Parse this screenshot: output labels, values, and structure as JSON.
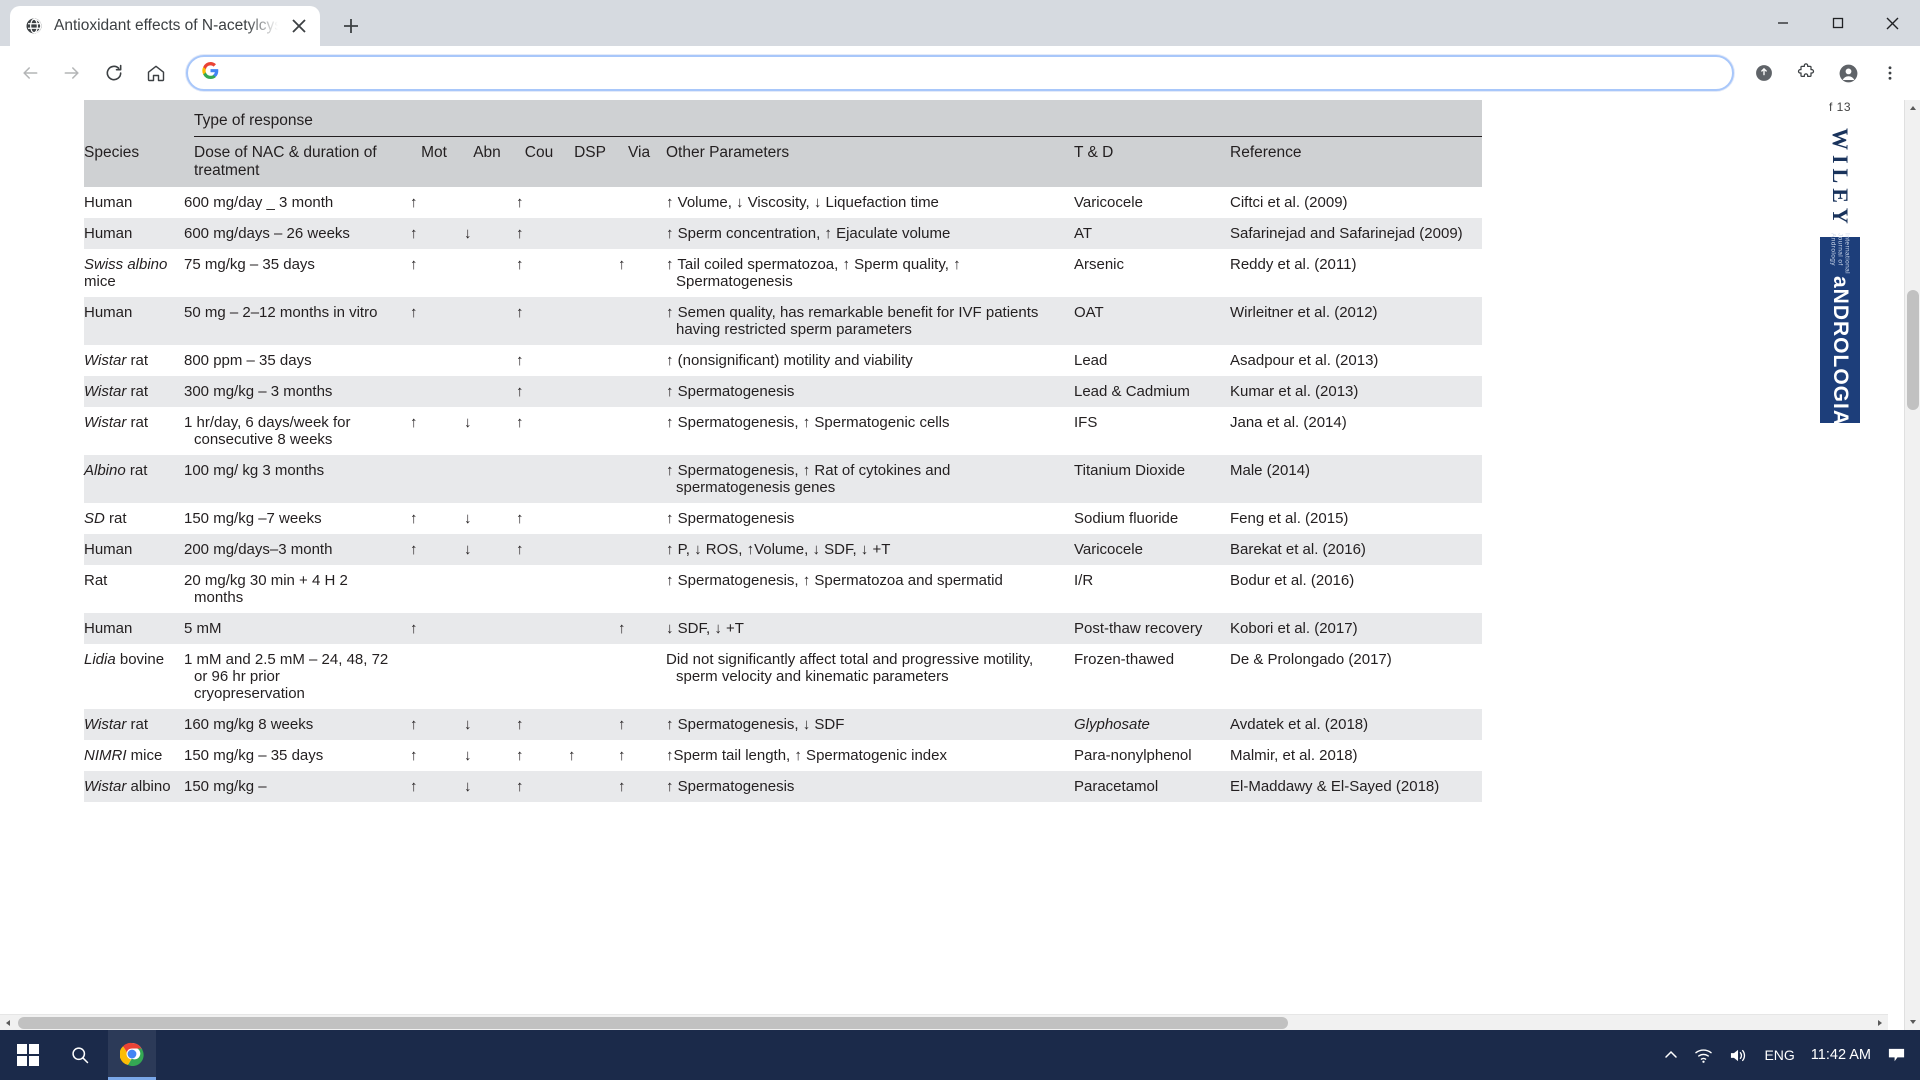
{
  "browser": {
    "tab": {
      "title": "Antioxidant effects of N-acetylcys",
      "favicon": "globe-icon",
      "close": "close-icon"
    },
    "new_tab_label": "+",
    "window_controls": {
      "minimize": "minimize-icon",
      "maximize": "maximize-icon",
      "close": "close-icon"
    },
    "toolbar": {
      "back": "back-arrow-icon",
      "forward": "forward-arrow-icon",
      "reload": "reload-icon",
      "home": "home-icon",
      "omnibox_value": "",
      "omnibox_placeholder": "",
      "search_icon": "google-g-icon",
      "share": "share-icon",
      "extensions": "puzzle-piece-icon",
      "profile": "profile-avatar-icon",
      "menu": "three-dot-menu-icon"
    }
  },
  "rail": {
    "page_label": "f 13",
    "publisher": "WILEY",
    "journal_sub": "International Journal of Andrology",
    "journal": "aNDROLOGIA"
  },
  "table": {
    "group_header": "Type of response",
    "columns": [
      "Species",
      "Dose of NAC & duration of treatment",
      "Mot",
      "Abn",
      "Cou",
      "DSP",
      "Via",
      "Other Parameters",
      "T & D",
      "Reference"
    ],
    "rows": [
      {
        "species": "Human",
        "species_italic": "",
        "dose": "600 mg/day _ 3 month",
        "mot": "↑",
        "abn": "",
        "cou": "↑",
        "dsp": "",
        "via": "",
        "other": "↑ Volume, ↓ Viscosity, ↓ Liquefaction time",
        "td": "Varicocele",
        "td_italic": false,
        "ref": "Ciftci et al. (2009)"
      },
      {
        "species": "Human",
        "species_italic": "",
        "dose": "600 mg/days – 26 weeks",
        "mot": "↑",
        "abn": "↓",
        "cou": "↑",
        "dsp": "",
        "via": "",
        "other": "↑ Sperm concentration, ↑ Ejaculate volume",
        "td": "AT",
        "td_italic": false,
        "ref": "Safarinejad and Safarinejad (2009)"
      },
      {
        "species": "mice",
        "species_italic": "Swiss albino",
        "dose": "75 mg/kg – 35 days",
        "mot": "↑",
        "abn": "",
        "cou": "↑",
        "dsp": "",
        "via": "↑",
        "other": "↑ Tail coiled spermatozoa, ↑ Sperm quality, ↑ Spermatogenesis",
        "td": "Arsenic",
        "td_italic": false,
        "ref": "Reddy et al. (2011)"
      },
      {
        "species": "Human",
        "species_italic": "",
        "dose": "50 mg – 2–12 months in vitro",
        "mot": "↑",
        "abn": "",
        "cou": "↑",
        "dsp": "",
        "via": "",
        "other": "↑ Semen quality, has remarkable benefit for IVF patients having restricted sperm parameters",
        "td": "OAT",
        "td_italic": false,
        "ref": "Wirleitner et al. (2012)"
      },
      {
        "species": "rat",
        "species_italic": "Wistar",
        "dose": "800 ppm – 35 days",
        "mot": "",
        "abn": "",
        "cou": "↑",
        "dsp": "",
        "via": "",
        "other": "↑ (nonsignificant) motility and viability",
        "td": "Lead",
        "td_italic": false,
        "ref": "Asadpour et al. (2013)"
      },
      {
        "species": "rat",
        "species_italic": "Wistar",
        "dose": "300 mg/kg – 3 months",
        "mot": "",
        "abn": "",
        "cou": "↑",
        "dsp": "",
        "via": "",
        "other": "↑ Spermatogenesis",
        "td": "Lead & Cadmium",
        "td_italic": false,
        "ref": "Kumar et al. (2013)"
      },
      {
        "species": "rat",
        "species_italic": "Wistar",
        "dose": "1 hr/day, 6 days/week for consecutive 8 weeks",
        "mot": "↑",
        "abn": "↓",
        "cou": "↑",
        "dsp": "",
        "via": "",
        "other": "↑ Spermatogenesis, ↑ Spermatogenic cells",
        "td": "IFS",
        "td_italic": false,
        "ref": "Jana et al. (2014)"
      },
      {
        "species": "rat",
        "species_italic": "Albino",
        "dose": "100 mg/ kg 3 months",
        "mot": "",
        "abn": "",
        "cou": "",
        "dsp": "",
        "via": "",
        "other": "↑ Spermatogenesis, ↑ Rat of cytokines and spermatogenesis genes",
        "td": "Titanium Dioxide",
        "td_italic": false,
        "ref": "Male (2014)"
      },
      {
        "species": "rat",
        "species_italic": "SD",
        "dose": "150 mg/kg –7 weeks",
        "mot": "↑",
        "abn": "↓",
        "cou": "↑",
        "dsp": "",
        "via": "",
        "other": "↑ Spermatogenesis",
        "td": "Sodium fluoride",
        "td_italic": false,
        "ref": "Feng et al. (2015)"
      },
      {
        "species": "Human",
        "species_italic": "",
        "dose": "200 mg/days–3 month",
        "mot": "↑",
        "abn": "↓",
        "cou": "↑",
        "dsp": "",
        "via": "",
        "other": "↑ P, ↓ ROS, ↑Volume, ↓ SDF, ↓ +T",
        "td": "Varicocele",
        "td_italic": false,
        "ref": "Barekat et al. (2016)"
      },
      {
        "species": "Rat",
        "species_italic": "",
        "dose": "20 mg/kg 30 min + 4 H 2 months",
        "mot": "",
        "abn": "",
        "cou": "",
        "dsp": "",
        "via": "",
        "other": "↑ Spermatogenesis, ↑ Spermatozoa and spermatid",
        "td": "I/R",
        "td_italic": false,
        "ref": "Bodur et al. (2016)"
      },
      {
        "species": "Human",
        "species_italic": "",
        "dose": "5 mM",
        "mot": "↑",
        "abn": "",
        "cou": "",
        "dsp": "",
        "via": "↑",
        "other": "↓ SDF, ↓ +T",
        "td": "Post-thaw recovery",
        "td_italic": false,
        "ref": "Kobori et al. (2017)"
      },
      {
        "species": "bovine",
        "species_italic": "Lidia",
        "dose": "1 mM and 2.5 mM – 24, 48, 72 or 96 hr prior cryopreservation",
        "mot": "",
        "abn": "",
        "cou": "",
        "dsp": "",
        "via": "",
        "other": "Did not significantly affect total and progressive motility, sperm velocity and kinematic parameters",
        "td": "Frozen-thawed",
        "td_italic": false,
        "ref": "De & Prolongado (2017)"
      },
      {
        "species": "rat",
        "species_italic": "Wistar",
        "dose": "160 mg/kg 8 weeks",
        "mot": "↑",
        "abn": "↓",
        "cou": "↑",
        "dsp": "",
        "via": "↑",
        "other": "↑ Spermatogenesis, ↓ SDF",
        "td": "Glyphosate",
        "td_italic": true,
        "ref": "Avdatek et al. (2018)"
      },
      {
        "species": "mice",
        "species_italic": "NIMRI",
        "dose": "150 mg/kg – 35 days",
        "mot": "↑",
        "abn": "↓",
        "cou": "↑",
        "dsp": "↑",
        "via": "↑",
        "other": "↑Sperm tail length, ↑ Spermatogenic index",
        "td": "Para-nonylphenol",
        "td_italic": false,
        "ref": "Malmir, et al. 2018)"
      },
      {
        "species": "albino",
        "species_italic": "Wistar",
        "dose": "150 mg/kg –",
        "mot": "↑",
        "abn": "↓",
        "cou": "↑",
        "dsp": "",
        "via": "↑",
        "other": "↑ Spermatogenesis",
        "td": "Paracetamol",
        "td_italic": false,
        "ref": "El-Maddawy & El-Sayed (2018)"
      }
    ]
  },
  "taskbar": {
    "start": "windows-start-icon",
    "search": "search-icon",
    "chrome": "chrome-icon",
    "tray": {
      "chevron": "chevron-up-icon",
      "network": "wifi-icon",
      "volume": "speaker-icon",
      "language": "ENG",
      "clock": "11:42 AM",
      "notifications": "notification-icon"
    }
  }
}
